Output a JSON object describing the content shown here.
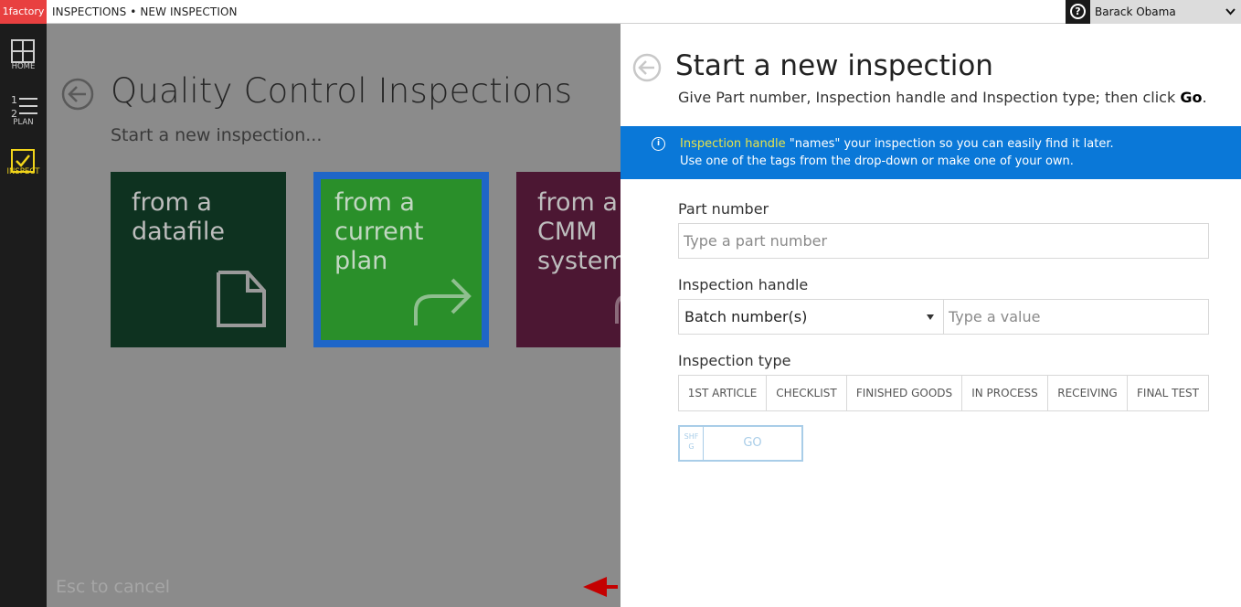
{
  "topbar": {
    "brand": "1factory",
    "breadcrumb": "INSPECTIONS • NEW INSPECTION",
    "user": "Barack Obama"
  },
  "rail": {
    "items": [
      {
        "label": "HOME",
        "icon": "grid-icon"
      },
      {
        "label": "PLAN",
        "icon": "numbered-list-icon"
      },
      {
        "label": "INSPECT",
        "icon": "checkbox-icon"
      }
    ]
  },
  "background": {
    "title": "Quality Control Inspections",
    "subtitle": "Start a new inspection...",
    "tiles": [
      {
        "label": "from a\ndatafile",
        "icon": "file-icon",
        "color": "#0e3220"
      },
      {
        "label": "from a\ncurrent\nplan",
        "icon": "share-arrow-icon",
        "color": "#2a8f2a"
      },
      {
        "label": "from a\nCMM\nsystem",
        "icon": "cmm-icon",
        "color": "#4c1733"
      }
    ],
    "esc_hint": "Esc to cancel"
  },
  "panel": {
    "title": "Start a new inspection",
    "subtitle_prefix": "Give Part number, Inspection handle and Inspection type; then click ",
    "subtitle_bold": "Go",
    "subtitle_suffix": ".",
    "banner": {
      "highlight": "Inspection handle",
      "line1_rest": " \"names\" your inspection so you can easily find it later.",
      "line2": "Use one of the tags from the drop-down or make one of your own."
    },
    "part_number": {
      "label": "Part number",
      "placeholder": "Type a part number",
      "value": ""
    },
    "inspection_handle": {
      "label": "Inspection handle",
      "selected": "Batch number(s)",
      "placeholder": "Type a value",
      "value": ""
    },
    "inspection_type": {
      "label": "Inspection type",
      "options": [
        "1ST ARTICLE",
        "CHECKLIST",
        "FINISHED GOODS",
        "IN PROCESS",
        "RECEIVING",
        "FINAL TEST"
      ]
    },
    "go": {
      "shortcut": "SHF\nG",
      "label": "GO"
    }
  },
  "colors": {
    "accent_blue": "#0a78d8",
    "brand_red": "#e84040",
    "inspect_active": "#f2d51a",
    "banner_highlight": "#e6e24a",
    "arrow_red": "#c40000"
  }
}
